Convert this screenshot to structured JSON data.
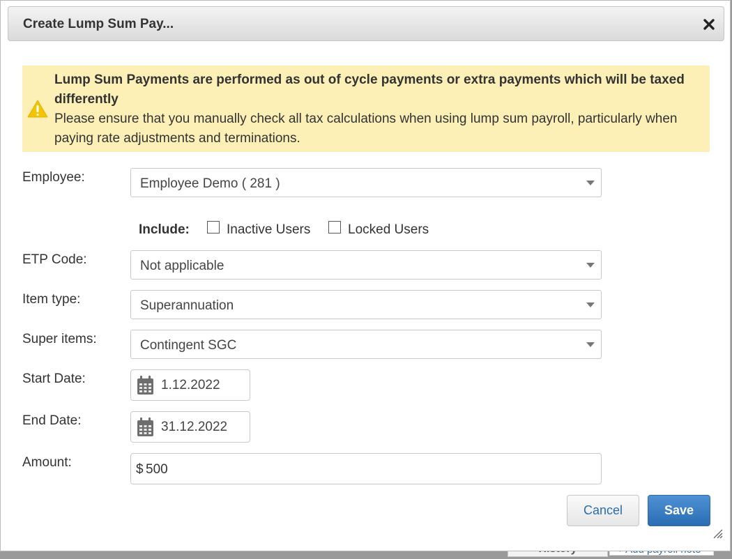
{
  "background": {
    "history_tab": "History",
    "add_note_link": "+ Add payroll note"
  },
  "dialog": {
    "title": "Create Lump Sum Pay...",
    "close_icon": "close-icon"
  },
  "alert": {
    "icon": "warning-icon",
    "heading": "Lump Sum Payments are performed as out of cycle payments or extra payments which will be taxed differently",
    "body": "Please ensure that you manually check all tax calculations when using lump sum payroll, particularly when paying rate adjustments and terminations."
  },
  "form": {
    "employee": {
      "label": "Employee:",
      "value": "Employee Demo ( 281 )"
    },
    "include": {
      "label": "Include:",
      "inactive_users": {
        "label": "Inactive Users",
        "checked": false
      },
      "locked_users": {
        "label": "Locked Users",
        "checked": false
      }
    },
    "etp_code": {
      "label": "ETP Code:",
      "value": "Not applicable"
    },
    "item_type": {
      "label": "Item type:",
      "value": "Superannuation"
    },
    "super_items": {
      "label": "Super items:",
      "value": "Contingent SGC"
    },
    "start_date": {
      "label": "Start Date:",
      "value": "1.12.2022"
    },
    "end_date": {
      "label": "End Date:",
      "value": "31.12.2022"
    },
    "amount": {
      "label": "Amount:",
      "currency": "$",
      "value": "500"
    }
  },
  "buttons": {
    "cancel": "Cancel",
    "save": "Save"
  },
  "colors": {
    "alert_bg": "#fdf0b7",
    "primary": "#2b6db3",
    "link": "#2a6ea6"
  }
}
